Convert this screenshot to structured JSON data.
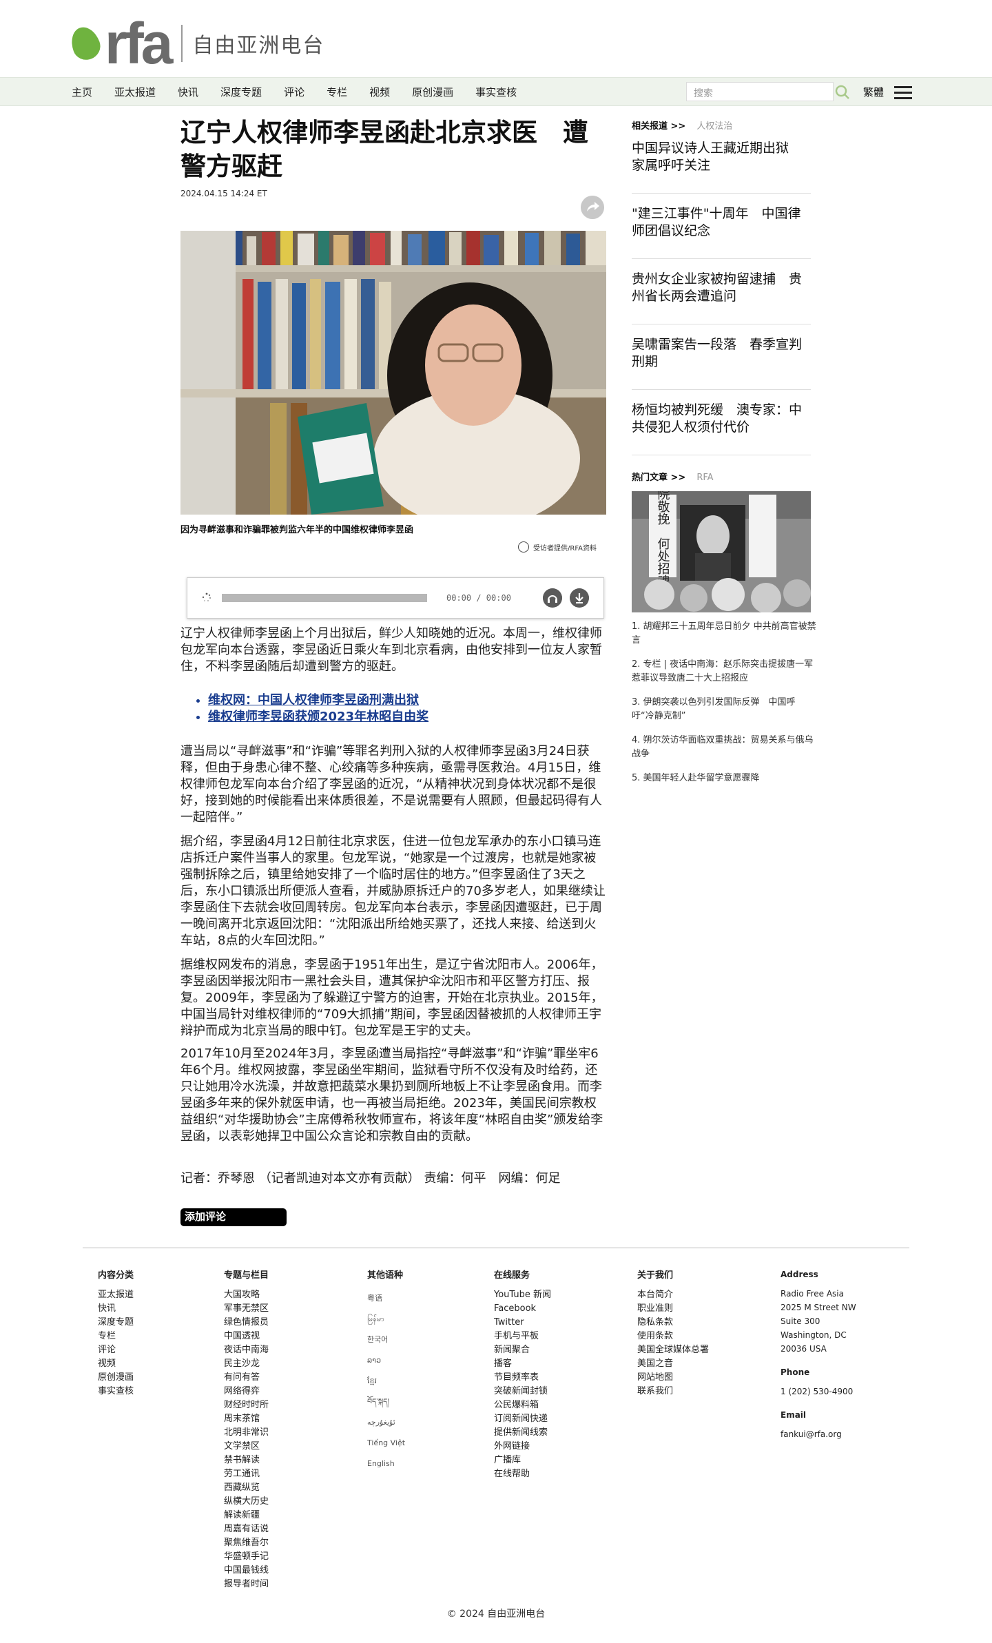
{
  "header": {
    "logo_text": "rfa",
    "logo_cn": "自由亚洲电台",
    "nav": [
      "主页",
      "亚太报道",
      "快讯",
      "深度专题",
      "评论",
      "专栏",
      "视频",
      "原创漫画",
      "事实查核"
    ],
    "search_placeholder": "搜索",
    "lang_toggle": "繁體"
  },
  "article": {
    "title": "辽宁人权律师李昱函赴北京求医　遭警方驱赶",
    "date": "2024.04.15 14:24 ET",
    "caption": "因为寻衅滋事和诈骗罪被判监六年半的中国维权律师李昱函",
    "credit": "受访者提供/RFA资料",
    "player_time": "00:00 / 00:00",
    "para1": "辽宁人权律师李昱函上个月出狱后，鲜少人知晓她的近况。本周一，维权律师包龙军向本台透露，李昱函近日乘火车到北京看病，由他安排到一位友人家暂住，不料李昱函随后却遭到警方的驱赶。",
    "links": [
      "维权网：中国人权律师李昱函刑满出狱",
      "维权律师李昱函获颁2023年林昭自由奖"
    ],
    "para2": "遭当局以“寻衅滋事”和“诈骗”等罪名判刑入狱的人权律师李昱函3月24日获释，但由于身患心律不整、心绞痛等多种疾病，亟需寻医救治。4月15日，维权律师包龙军向本台介绍了李昱函的近况，“从精神状况到身体状况都不是很好，接到她的时候能看出来体质很差，不是说需要有人照顾，但最起码得有人一起陪伴。”",
    "para3": "据介绍，李昱函4月12日前往北京求医，住进一位包龙军承办的东小口镇马连店拆迁户案件当事人的家里。包龙军说，“她家是一个过渡房，也就是她家被强制拆除之后，镇里给她安排了一个临时居住的地方。”但李昱函住了3天之后，东小口镇派出所便派人查看，并威胁原拆迁户的70多岁老人，如果继续让李昱函住下去就会收回周转房。包龙军向本台表示，李昱函因遭驱赶，已于周一晚间离开北京返回沈阳：“沈阳派出所给她买票了，还找人来接、给送到火车站，8点的火车回沈阳。”",
    "para4": "据维权网发布的消息，李昱函于1951年出生，是辽宁省沈阳市人。2006年，李昱函因举报沈阳市一黑社会头目，遭其保护伞沈阳市和平区警方打压、报复。2009年，李昱函为了躲避辽宁警方的迫害，开始在北京执业。2015年，中国当局针对维权律师的“709大抓捕”期间，李昱函因替被抓的人权律师王宇辩护而成为北京当局的眼中钉。包龙军是王宇的丈夫。",
    "para5": "2017年10月至2024年3月，李昱函遭当局指控“寻衅滋事”和“诈骗”罪坐牢6年6个月。维权网披露，李昱函坐牢期间，监狱看守所不仅没有及时给药，还只让她用冷水洗澡，并故意把蔬菜水果扔到厕所地板上不让李昱函食用。而李昱函多年来的保外就医申请，也一再被当局拒绝。2023年，美国民间宗教权益组织“对华援助协会”主席傅希秋牧师宣布，将该年度“林昭自由奖”颁发给李昱函，以表彰她捍卫中国公众言论和宗教自由的贡献。",
    "byline": "记者：乔琴恩 （记者凯迪对本文亦有贡献） 责编：何平　网编：何足",
    "comment_button": "添加评论"
  },
  "sidebar": {
    "related_label": "相关报道 >>",
    "related_tag": "人权法治",
    "related": [
      "中国异议诗人王藏近期出狱　家属呼吁关注",
      "\"建三江事件\"十周年　中国律师团倡议纪念",
      "贵州女企业家被拘留逮捕　贵州省长两会遭追问",
      "吴啸雷案告一段落　春季宣判刑期",
      "杨恒均被判死缓　澳专家：中共侵犯人权须付代价"
    ],
    "hot_label": "热门文章 >>",
    "hot_tag": "RFA",
    "hot_img_text": "中央美院敬挽　何处招魂",
    "hot": [
      "1. 胡耀邦三十五周年忌日前夕 中共前高官被禁言",
      "2. 专栏 | 夜话中南海：赵乐际突击提拔唐一军惹菲议导致唐二十大上招报应",
      "3. 伊朗突袭以色列引发国际反弹　中国呼吁“冷静克制”",
      "4. 朔尔茨访华面临双重挑战：贸易关系与俄乌战争",
      "5. 美国年轻人赴华留学意愿骤降"
    ]
  },
  "footer": {
    "cat_head": "内容分类",
    "cat": [
      "亚太报道",
      "快讯",
      "深度专题",
      "专栏",
      "评论",
      "视频",
      "原创漫画",
      "事实查核"
    ],
    "topics_head": "专题与栏目",
    "topics": [
      "大国攻略",
      "军事无禁区",
      "绿色情报员",
      "中国透视",
      "夜话中南海",
      "民主沙龙",
      "有问有答",
      "网络得弈",
      "财经时时所",
      "周末茶馆",
      "北明非常识",
      "文学禁区",
      "禁书解读",
      "劳工通讯",
      "西藏纵览",
      "纵横大历史",
      "解读新疆",
      "周嘉有话说",
      "聚焦维吾尔",
      "华盛顿手记",
      "中国最钱线",
      "报导者时间"
    ],
    "langs_head": "其他语种",
    "langs": [
      "粤语",
      "မြန်မာ",
      "한국어",
      "ລາວ",
      "ខ្មែរ",
      "བོད་སྐད།",
      "ئۇيغۇرچە",
      "Tiếng Việt",
      "English"
    ],
    "online_head": "在线服务",
    "online": [
      "YouTube 新闻",
      "Facebook",
      "Twitter",
      "手机与平板",
      "新闻聚合",
      "播客",
      "节目频率表",
      "突破新闻封锁",
      "公民爆料箱",
      "订阅新闻快递",
      "提供新闻线索",
      "外网链接",
      "广播库",
      "在线帮助"
    ],
    "about_head": "关于我们",
    "about": [
      "本台简介",
      "职业准则",
      "隐私条款",
      "使用条款",
      "美国全球媒体总署",
      "美国之音",
      "网站地图",
      "联系我们"
    ],
    "address_head": "Address",
    "address": [
      "Radio Free Asia",
      "2025 M Street NW",
      "Suite 300",
      "Washington, DC",
      "20036 USA"
    ],
    "phone_head": "Phone",
    "phone": "1 (202) 530-4900",
    "email_head": "Email",
    "email": "fankui@rfa.org",
    "copyright": "© 2024 自由亚洲电台"
  }
}
